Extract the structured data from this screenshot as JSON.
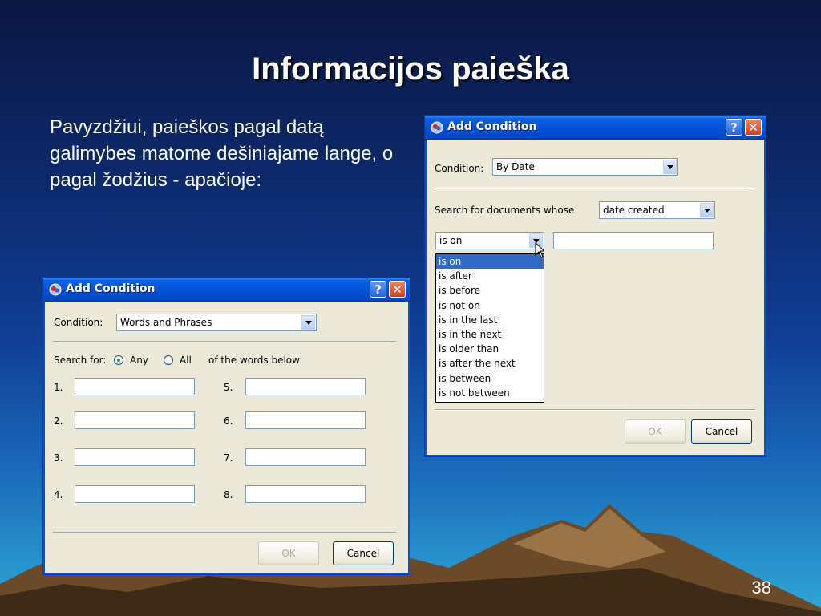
{
  "slide": {
    "title": "Informacijos paieška",
    "text": "Pavyzdžiui, paieškos pagal datą galimybes matome dešiniajame lange, o pagal žodžius - apačioje:",
    "page_number": "38"
  },
  "dialog_words": {
    "title": "Add Condition",
    "help": "?",
    "close": "✕",
    "condition_label": "Condition:",
    "condition_value": "Words and Phrases",
    "search_for_label": "Search for:",
    "any_label": "Any",
    "all_label": "All",
    "suffix_label": "of the words below",
    "fields": [
      "1.",
      "2.",
      "3.",
      "4.",
      "5.",
      "6.",
      "7.",
      "8."
    ],
    "ok_label": "OK",
    "cancel_label": "Cancel"
  },
  "dialog_date": {
    "title": "Add Condition",
    "help": "?",
    "close": "✕",
    "condition_label": "Condition:",
    "condition_value": "By Date",
    "search_docs_label": "Search for documents whose",
    "date_field_value": "date created",
    "operator_value": "is on",
    "operator_options": [
      "is on",
      "is after",
      "is before",
      "is not on",
      "is in the last",
      "is in the next",
      "is older than",
      "is after the next",
      "is between",
      "is not between"
    ],
    "selected_option": "is on",
    "ok_label": "OK",
    "cancel_label": "Cancel"
  },
  "colors": {
    "xp_title_blue": "#0553d6",
    "dialog_face": "#ece9d8",
    "selection_blue": "#316ac5"
  }
}
